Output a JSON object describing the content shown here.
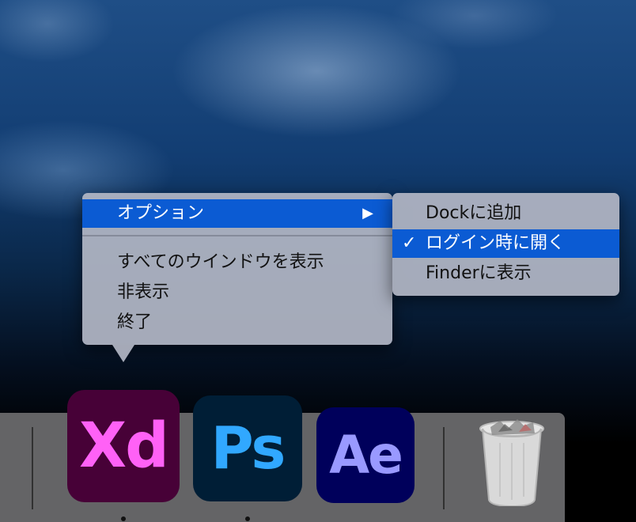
{
  "context_menu": {
    "items": [
      {
        "label": "オプション",
        "has_submenu": true,
        "submenu_arrow": "▶",
        "highlighted": true
      },
      {
        "label": "すべてのウインドウを表示"
      },
      {
        "label": "非表示"
      },
      {
        "label": "終了"
      }
    ]
  },
  "submenu": {
    "items": [
      {
        "label": "Dockに追加",
        "checked": false
      },
      {
        "label": "ログイン時に開く",
        "checked": true,
        "check_mark": "✓",
        "highlighted": true
      },
      {
        "label": "Finderに表示",
        "checked": false
      }
    ]
  },
  "dock": {
    "apps": [
      {
        "label": "Xd",
        "name": "Adobe XD",
        "running": true,
        "bg": "#470137",
        "fg": "#ff61f6"
      },
      {
        "label": "Ps",
        "name": "Adobe Photoshop",
        "running": true,
        "bg": "#001e36",
        "fg": "#31a8ff"
      },
      {
        "label": "Ae",
        "name": "Adobe After Effects",
        "running": false,
        "bg": "#00005b",
        "fg": "#9999ff"
      }
    ],
    "trash_icon": "trash-icon"
  },
  "colors": {
    "selection": "#0b5bd3",
    "menu_bg": "#b2b6c4"
  }
}
